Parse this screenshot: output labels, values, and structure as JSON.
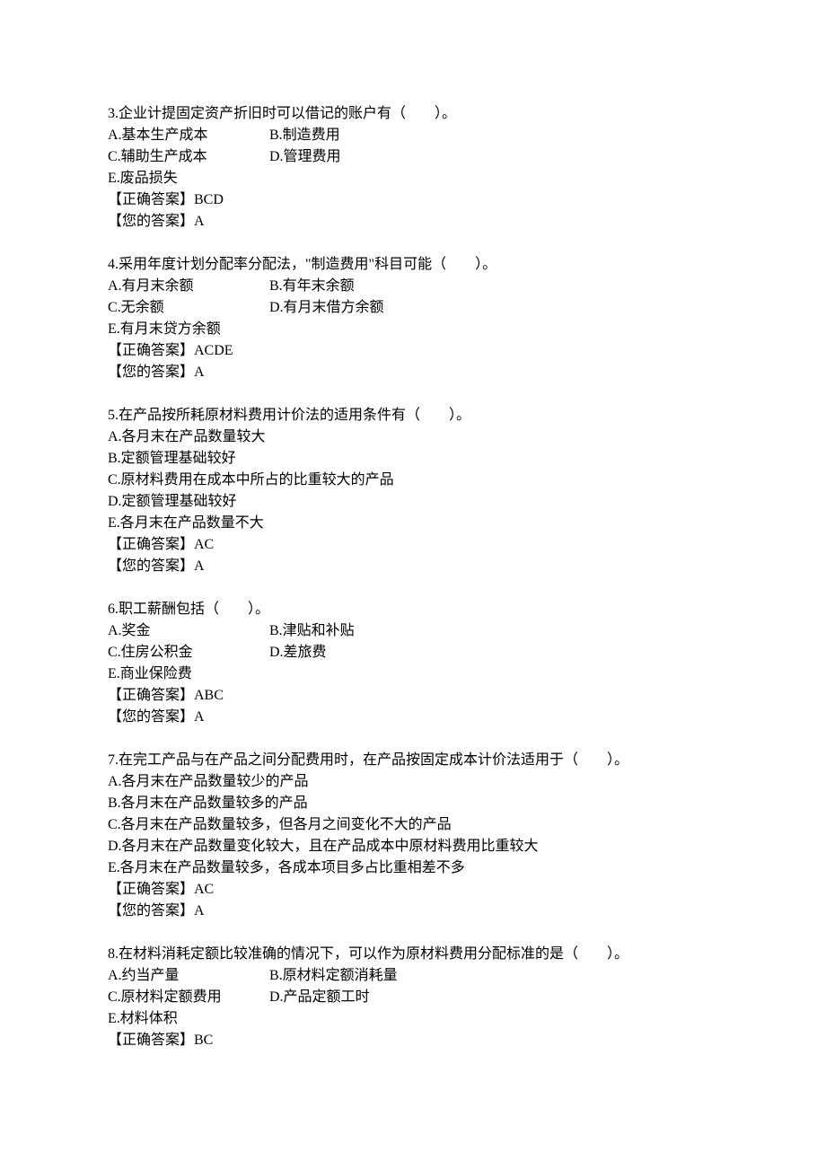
{
  "questions": [
    {
      "num": "3",
      "stem": "3.企业计提固定资产折旧时可以借记的账户有（　　）。",
      "opt_a": "A.基本生产成本",
      "opt_b": "B.制造费用",
      "opt_c": "C.辅助生产成本",
      "opt_d": "D.管理费用",
      "opt_e": "E.废品损失",
      "correct": "【正确答案】BCD",
      "your": "【您的答案】A"
    },
    {
      "num": "4",
      "stem": "4.采用年度计划分配率分配法，\"制造费用\"科目可能（　　）。",
      "opt_a": "A.有月末余额",
      "opt_b": "B.有年末余额",
      "opt_c": "C.无余额",
      "opt_d": "D.有月末借方余额",
      "opt_e": "E.有月末贷方余额",
      "correct": "【正确答案】ACDE",
      "your": "【您的答案】A"
    },
    {
      "num": "5",
      "stem": "5.在产品按所耗原材料费用计价法的适用条件有（　　）。",
      "opt_a": "A.各月末在产品数量较大",
      "opt_b": "B.定额管理基础较好",
      "opt_c": "C.原材料费用在成本中所占的比重较大的产品",
      "opt_d": "D.定额管理基础较好",
      "opt_e": "E.各月末在产品数量不大",
      "correct": "【正确答案】AC",
      "your": "【您的答案】A"
    },
    {
      "num": "6",
      "stem": "6.职工薪酬包括（　　）。",
      "opt_a": "A.奖金",
      "opt_b": "B.津贴和补贴",
      "opt_c": "C.住房公积金",
      "opt_d": "D.差旅费",
      "opt_e": "E.商业保险费",
      "correct": "【正确答案】ABC",
      "your": "【您的答案】A"
    },
    {
      "num": "7",
      "stem": "7.在完工产品与在产品之间分配费用时，在产品按固定成本计价法适用于（　　）。",
      "opt_a": "A.各月末在产品数量较少的产品",
      "opt_b": "B.各月末在产品数量较多的产品",
      "opt_c": "C.各月末在产品数量较多，但各月之间变化不大的产品",
      "opt_d": "D.各月末在产品数量变化较大，且在产品成本中原材料费用比重较大",
      "opt_e": "E.各月末在产品数量较多，各成本项目多占比重相差不多",
      "correct": "【正确答案】AC",
      "your": "【您的答案】A"
    },
    {
      "num": "8",
      "stem": "8.在材料消耗定额比较准确的情况下，可以作为原材料费用分配标准的是（　　）。",
      "opt_a": "A.约当产量",
      "opt_b": "B.原材料定额消耗量",
      "opt_c": "C.原材料定额费用",
      "opt_d": "D.产品定额工时",
      "opt_e": "E.材料体积",
      "correct": "【正确答案】BC",
      "your": ""
    }
  ],
  "layouts": {
    "q3": "two-col",
    "q4": "two-col",
    "q5": "one-col",
    "q6": "two-col",
    "q7": "one-col",
    "q8": "two-col"
  }
}
